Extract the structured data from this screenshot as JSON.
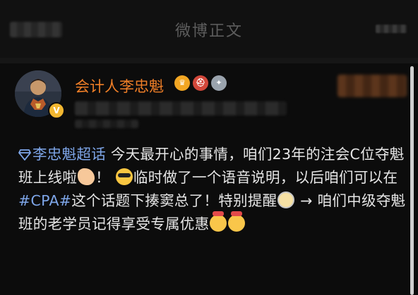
{
  "header": {
    "title": "微博正文"
  },
  "post": {
    "username": "会计人李忠魁",
    "badges": [
      "crown-badge",
      "helmet-badge",
      "medal-badge"
    ],
    "text": {
      "topic": "李忠魁超话",
      "part1": " 今天最开心的事情，咱们23年的注会C位夺魁班上线啦",
      "part2": "！",
      "part3": "临时做了一个语音说明，以后咱们可以在",
      "hashtag": "#CPA#",
      "part4": "这个话题下揍窦总了！特别提醒",
      "part5": " → 咱们中级夺魁班的老学员记得享受专属优惠"
    },
    "emoji_names": [
      "clapping-hand-emoji",
      "sunglasses-emoji",
      "glasses-emoji",
      "love-emoji",
      "love-emoji"
    ]
  },
  "colors": {
    "username": "#f07f27",
    "link": "#7ea6e9",
    "background": "#0c0c0c",
    "text": "#e6e6e6"
  }
}
